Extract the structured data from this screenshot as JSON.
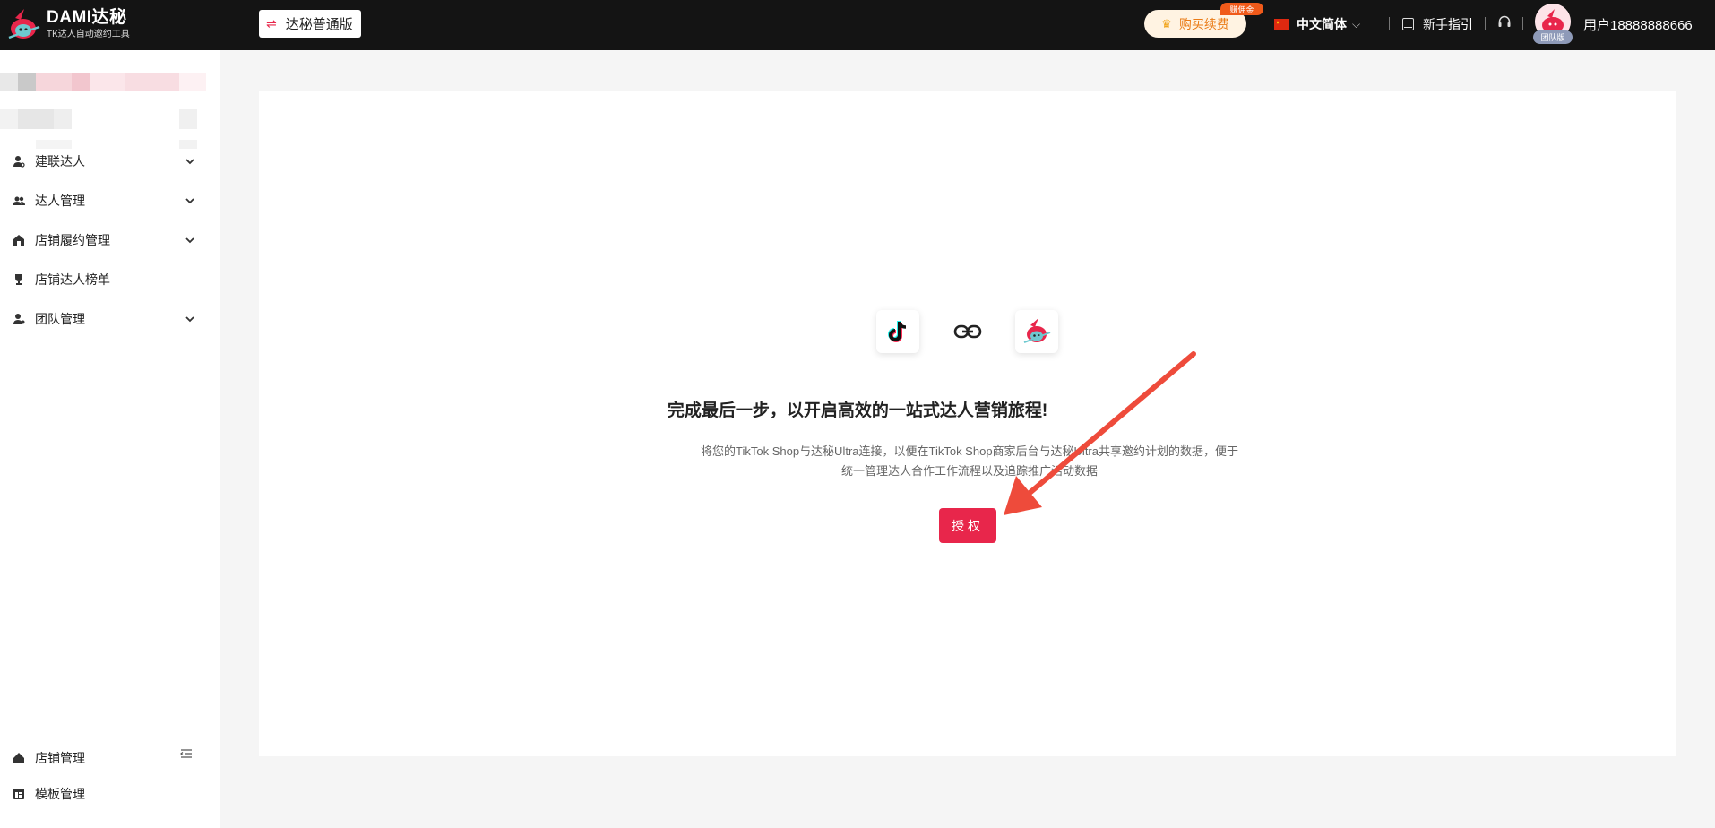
{
  "header": {
    "logo_title": "DAMI达秘",
    "logo_subtitle": "TK达人自动邀约工具",
    "version_label": "达秘普通版",
    "buy_label": "购买续费",
    "earn_badge": "赚佣金",
    "language": "中文简体",
    "guide_label": "新手指引",
    "team_badge": "团队版",
    "username": "用户18888888666"
  },
  "sidebar": {
    "items": [
      {
        "label": "建联达人",
        "icon": "user-link-icon",
        "expandable": true
      },
      {
        "label": "达人管理",
        "icon": "users-icon",
        "expandable": true
      },
      {
        "label": "店铺履约管理",
        "icon": "store-icon",
        "expandable": true
      },
      {
        "label": "店铺达人榜单",
        "icon": "trophy-icon",
        "expandable": false
      },
      {
        "label": "团队管理",
        "icon": "team-icon",
        "expandable": true
      }
    ],
    "bottom_items": [
      {
        "label": "店铺管理",
        "icon": "home-icon"
      },
      {
        "label": "模板管理",
        "icon": "template-icon"
      }
    ]
  },
  "main": {
    "title": "完成最后一步，以开启高效的一站式达人营销旅程!",
    "description": "将您的TikTok Shop与达秘Ultra连接，以便在TikTok Shop商家后台与达秘Ultra共享邀约计划的数据，便于统一管理达人合作工作流程以及追踪推广活动数据",
    "auth_button": "授权"
  },
  "colors": {
    "accent": "#e8264b",
    "header_bg": "#141414",
    "annotation_arrow": "#ee4b3b"
  }
}
